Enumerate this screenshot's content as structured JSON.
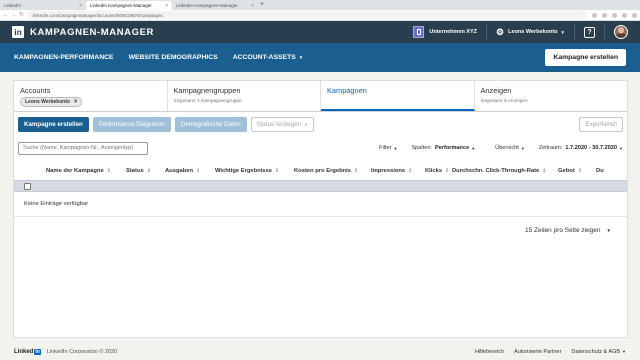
{
  "browser": {
    "tabs": [
      {
        "label": "LinkedIn",
        "active": false
      },
      {
        "label": "LinkedIn Kampagnen-Manager",
        "active": true
      },
      {
        "label": "LinkedIn Kampagnen-Manager",
        "active": false
      }
    ],
    "url": "linkedin.com/campaignmanager/accounts/508019875/campaigns"
  },
  "header": {
    "logo": "in",
    "title": "KAMPAGNEN-MANAGER",
    "company": "Unternehmen XYZ",
    "account": "Leons Werbekonto",
    "help": "?"
  },
  "subnav": {
    "items": [
      {
        "label": "KAMPAGNEN-PERFORMANCE",
        "dropdown": false
      },
      {
        "label": "WEBSITE DEMOGRAPHICS",
        "dropdown": false
      },
      {
        "label": "ACCOUNT-ASSETS",
        "dropdown": true
      }
    ],
    "create_button": "Kampagne erstellen"
  },
  "tabs": {
    "accounts": {
      "title": "Accounts",
      "chip": "Leons Werbekonto"
    },
    "groups": {
      "title": "Kampagnengruppen",
      "sub": "Insgesamt 1 Kampagnengruppe"
    },
    "campaigns": {
      "title": "Kampagnen"
    },
    "ads": {
      "title": "Anzeigen",
      "sub": "Insgesamt 0 Anzeigen"
    }
  },
  "toolbar": {
    "create": "Kampagne erstellen",
    "performance_chart": "Performance-Diagramm",
    "demographics": "Demografische Daten",
    "set_status": "Status festlegen",
    "export": "Exportieren"
  },
  "filters": {
    "search_placeholder": "Suche (Name, Kampagnen-Nr., Anzeigentyp)",
    "filter_label": "Filter",
    "columns_label": "Spalten:",
    "columns_value": "Performance",
    "overview_label": "Übersicht",
    "period_label": "Zeitraum:",
    "period_value": "1.7.2020 - 30.7.2020"
  },
  "table": {
    "headers": [
      "Name der Kampagne",
      "Status",
      "Ausgaben",
      "Wichtige Ergebnisse",
      "Kosten pro Ergebnis",
      "Impressions",
      "Klicks",
      "Durchschn. Click-Through-Rate",
      "Gebot",
      "Du"
    ],
    "empty": "Keine Einträge verfügbar",
    "pager": "15 Zeilen pro Seite zeigen"
  },
  "footer": {
    "brand": "Linked",
    "brand_in": "in",
    "copyright": "LinkedIn Corporation © 2020",
    "links": [
      "Hilfebereich",
      "Autorisierte Partner",
      "Datenschutz & AGB"
    ]
  },
  "colors": {
    "header_bg": "#293e4e",
    "subnav_bg": "#1a5f8f",
    "accent": "#0a66c2",
    "primary_button": "#1a5f8f",
    "disabled_button": "#9fc0d8"
  }
}
